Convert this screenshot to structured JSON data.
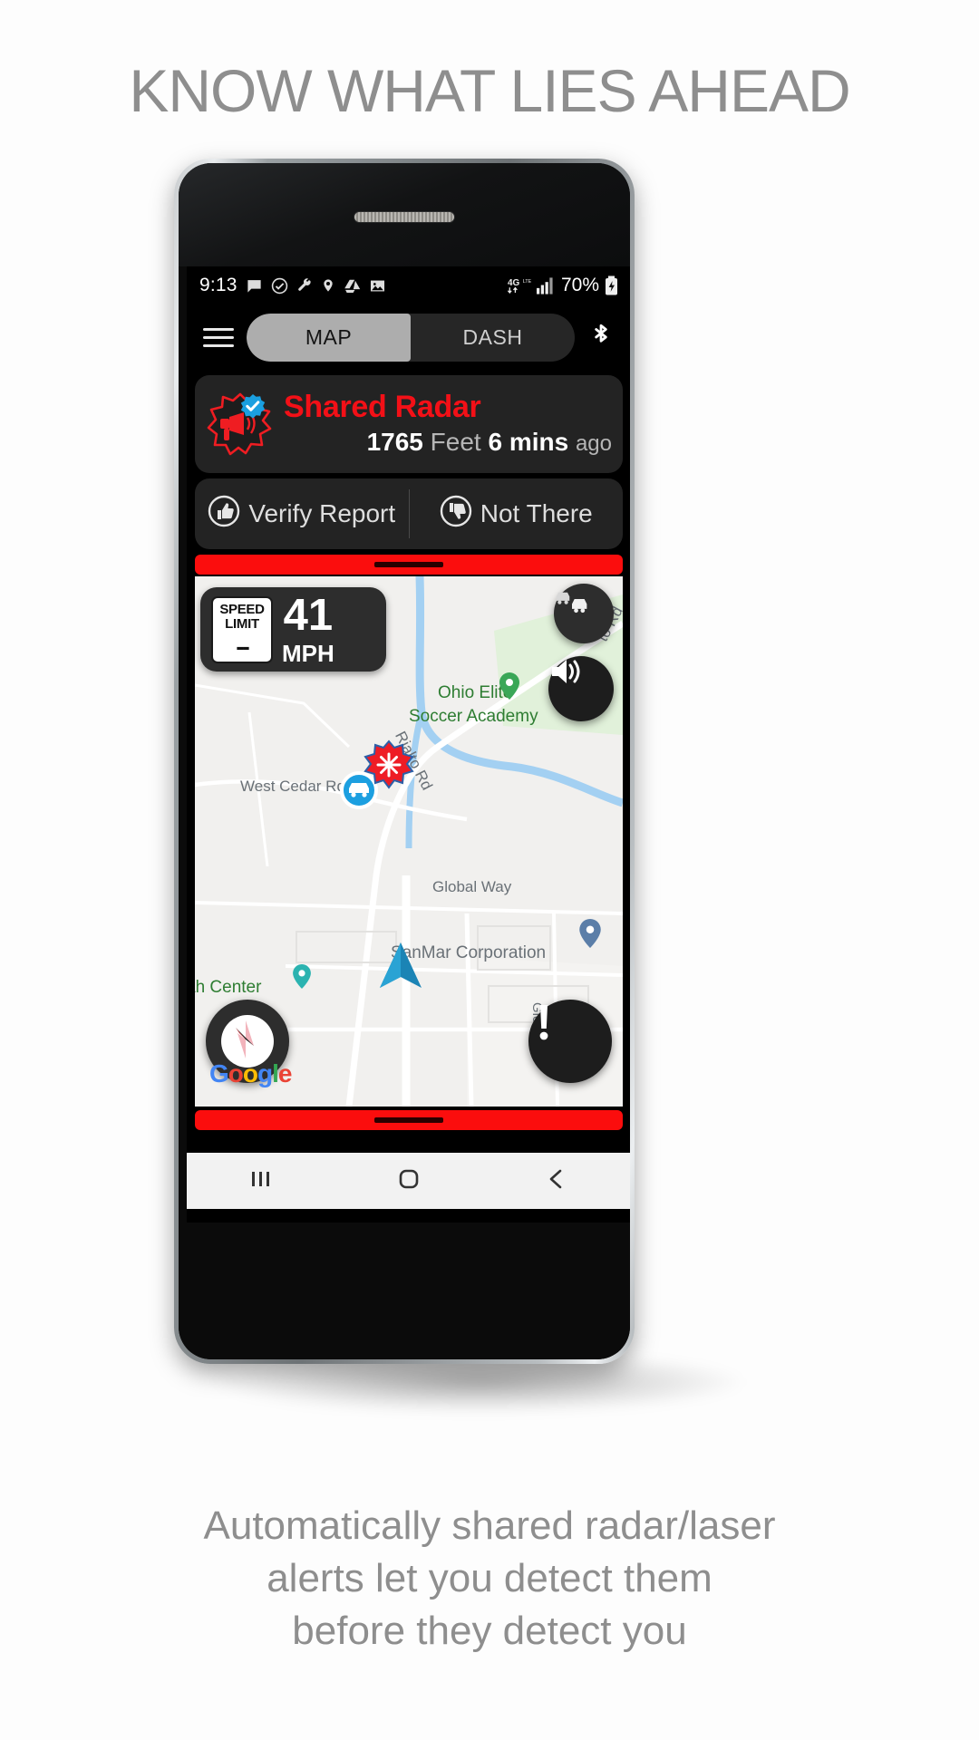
{
  "headline": "KNOW WHAT LIES AHEAD",
  "caption": {
    "line1": "Automatically shared radar/laser",
    "line2": "alerts let you detect them",
    "line3": "before they detect you"
  },
  "statusbar": {
    "time": "9:13",
    "icons_left": [
      "message-icon",
      "check-circle-icon",
      "wrench-icon",
      "location-icon",
      "drive-icon",
      "photo-icon"
    ],
    "network": "4G",
    "signal": "signal-bars-icon",
    "battery_percent": "70%",
    "battery_icon": "battery-charging-icon"
  },
  "appbar": {
    "menu_icon": "hamburger-menu-icon",
    "tabs": [
      {
        "label": "MAP",
        "active": true
      },
      {
        "label": "DASH",
        "active": false
      }
    ],
    "bluetooth_icon": "bluetooth-icon"
  },
  "alert": {
    "icon": "shared-radar-verified-icon",
    "title": "Shared Radar",
    "distance_value": "1765",
    "distance_unit": "Feet",
    "age_value": "6 mins",
    "age_suffix": "ago"
  },
  "actions": [
    {
      "label": "Verify Report",
      "icon": "thumbs-up-icon"
    },
    {
      "label": "Not There",
      "icon": "thumbs-down-icon"
    }
  ],
  "speed": {
    "limit_label_line1": "SPEED",
    "limit_label_line2": "LIMIT",
    "limit_value": "--",
    "current": "41",
    "unit": "MPH"
  },
  "map": {
    "labels": [
      {
        "text": "Ohio Elite",
        "type": "poi"
      },
      {
        "text": "Soccer Academy",
        "type": "poi"
      },
      {
        "text": "Rialto Rd",
        "type": "road"
      },
      {
        "text": "to Rd",
        "type": "road"
      },
      {
        "text": "West Cedar Rd",
        "type": "road"
      },
      {
        "text": "Global Way",
        "type": "road"
      },
      {
        "text": "SanMar Corporation",
        "type": "poi"
      },
      {
        "text": "ah Center",
        "type": "poi"
      },
      {
        "text": "Global W",
        "type": "road"
      }
    ],
    "attribution": "Google",
    "buttons": [
      {
        "name": "traffic-toggle-button",
        "icon": "traffic-cars-icon"
      },
      {
        "name": "sound-toggle-button",
        "icon": "speaker-icon"
      },
      {
        "name": "compass-button",
        "icon": "compass-icon"
      },
      {
        "name": "report-button",
        "icon": "exclamation-icon"
      }
    ],
    "markers": [
      {
        "name": "radar-alert-marker",
        "icon": "red-starburst-icon"
      },
      {
        "name": "nearby-car-marker",
        "icon": "blue-car-icon"
      },
      {
        "name": "user-heading-marker",
        "icon": "blue-arrow-icon"
      },
      {
        "name": "place-pin-green",
        "icon": "green-pin-icon"
      },
      {
        "name": "place-pin-blue",
        "icon": "blue-pin-icon"
      }
    ]
  },
  "navbar": {
    "recents": "|||",
    "home": "home-icon",
    "back": "back-icon"
  },
  "colors": {
    "alert_red": "#f31017",
    "bar_red": "#fb0d0d",
    "headline_gray": "#8e8e8e",
    "card_bg": "#232323",
    "active_tab": "#adadad"
  }
}
